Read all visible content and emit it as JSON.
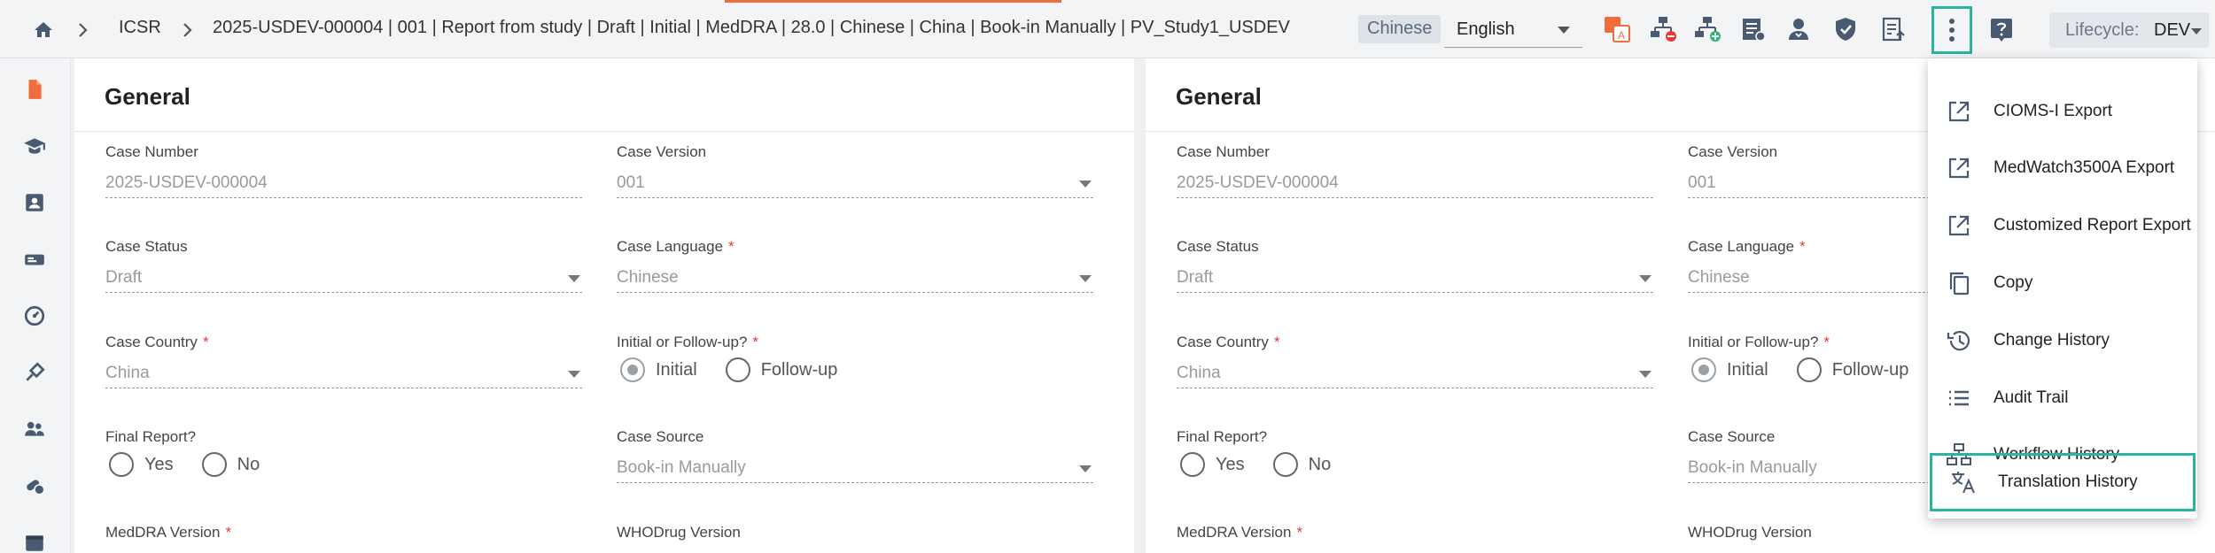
{
  "breadcrumb": {
    "module": "ICSR",
    "case_title": "2025-USDEV-000004 | 001 | Report from study | Draft | Initial | MedDRA | 28.0 | Chinese | China | Book-in Manually | PV_Study1_USDEV"
  },
  "header": {
    "language_badge": "Chinese",
    "language_select": "English",
    "lifecycle_label": "Lifecycle:",
    "lifecycle_value": "DEV"
  },
  "panels": [
    {
      "title": "General",
      "case_number_label": "Case Number",
      "case_number_value": "2025-USDEV-000004",
      "case_version_label": "Case Version",
      "case_version_value": "001",
      "case_status_label": "Case Status",
      "case_status_value": "Draft",
      "case_language_label": "Case Language",
      "case_language_value": "Chinese",
      "case_country_label": "Case Country",
      "case_country_value": "China",
      "initial_followup_label": "Initial or Follow-up?",
      "initial_option": "Initial",
      "followup_option": "Follow-up",
      "final_report_label": "Final Report?",
      "yes_option": "Yes",
      "no_option": "No",
      "case_source_label": "Case Source",
      "case_source_value": "Book-in Manually",
      "meddra_version_label": "MedDRA Version",
      "whodrug_version_label": "WHODrug Version"
    },
    {
      "title": "General",
      "case_number_label": "Case Number",
      "case_number_value": "2025-USDEV-000004",
      "case_version_label": "Case Version",
      "case_version_value": "001",
      "case_status_label": "Case Status",
      "case_status_value": "Draft",
      "case_language_label": "Case Language",
      "case_language_value": "Chinese",
      "case_country_label": "Case Country",
      "case_country_value": "China",
      "initial_followup_label": "Initial or Follow-up?",
      "initial_option": "Initial",
      "followup_option": "Follow-up",
      "final_report_label": "Final Report?",
      "yes_option": "Yes",
      "no_option": "No",
      "case_source_label": "Case Source",
      "case_source_value": "Book-in Manually",
      "meddra_version_label": "MedDRA Version",
      "whodrug_version_label": "WHODrug Version"
    }
  ],
  "required_marker": "*",
  "menu": {
    "items": [
      {
        "label": "CIOMS-I Export",
        "icon": "external-link-icon"
      },
      {
        "label": "MedWatch3500A Export",
        "icon": "external-link-icon"
      },
      {
        "label": "Customized Report Export",
        "icon": "external-link-icon"
      },
      {
        "label": "Copy",
        "icon": "copy-icon"
      },
      {
        "label": "Change History",
        "icon": "history-icon"
      },
      {
        "label": "Audit Trail",
        "icon": "list-icon"
      },
      {
        "label": "Workflow History",
        "icon": "workflow-icon"
      },
      {
        "label": "Translation History",
        "icon": "translate-icon"
      }
    ]
  },
  "colors": {
    "accent_teal": "#2bb3a0",
    "required_red": "#e53935",
    "active_orange": "#ef6c3c"
  }
}
